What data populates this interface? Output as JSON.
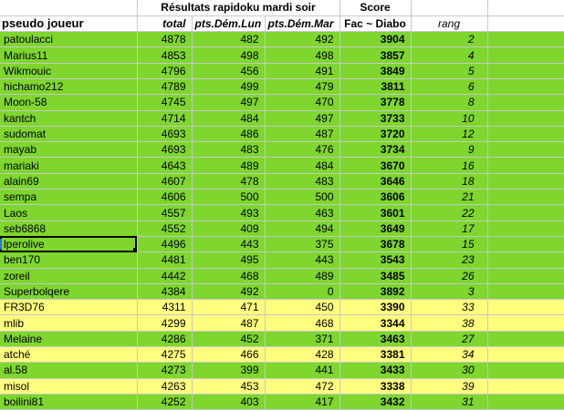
{
  "header": {
    "title": "Résultats rapidoku mardi soir",
    "score_group": "Score",
    "columns": [
      "pseudo joueur",
      "total",
      "pts.Dém.Lun",
      "pts.Dém.Mar",
      "Fac ~ Diabo",
      "rang"
    ]
  },
  "rows": [
    {
      "name": "patoulacci",
      "total": "4878",
      "lun": "482",
      "mar": "492",
      "score": "3904",
      "rang": "2",
      "band": "green"
    },
    {
      "name": "Marius11",
      "total": "4853",
      "lun": "498",
      "mar": "498",
      "score": "3857",
      "rang": "4",
      "band": "green"
    },
    {
      "name": "Wikmouic",
      "total": "4796",
      "lun": "456",
      "mar": "491",
      "score": "3849",
      "rang": "5",
      "band": "green"
    },
    {
      "name": "hichamo212",
      "total": "4789",
      "lun": "499",
      "mar": "479",
      "score": "3811",
      "rang": "6",
      "band": "green"
    },
    {
      "name": "Moon-58",
      "total": "4745",
      "lun": "497",
      "mar": "470",
      "score": "3778",
      "rang": "8",
      "band": "green"
    },
    {
      "name": "kantch",
      "total": "4714",
      "lun": "484",
      "mar": "497",
      "score": "3733",
      "rang": "10",
      "band": "green"
    },
    {
      "name": "sudomat",
      "total": "4693",
      "lun": "486",
      "mar": "487",
      "score": "3720",
      "rang": "12",
      "band": "green"
    },
    {
      "name": "mayab",
      "total": "4693",
      "lun": "483",
      "mar": "476",
      "score": "3734",
      "rang": "9",
      "band": "green"
    },
    {
      "name": "mariaki",
      "total": "4643",
      "lun": "489",
      "mar": "484",
      "score": "3670",
      "rang": "16",
      "band": "green"
    },
    {
      "name": "alain69",
      "total": "4607",
      "lun": "478",
      "mar": "483",
      "score": "3646",
      "rang": "18",
      "band": "green"
    },
    {
      "name": "sempa",
      "total": "4606",
      "lun": "500",
      "mar": "500",
      "score": "3606",
      "rang": "21",
      "band": "green"
    },
    {
      "name": "Laos",
      "total": "4557",
      "lun": "493",
      "mar": "463",
      "score": "3601",
      "rang": "22",
      "band": "green"
    },
    {
      "name": "seb6868",
      "total": "4552",
      "lun": "409",
      "mar": "494",
      "score": "3649",
      "rang": "17",
      "band": "green"
    },
    {
      "name": "lperolive",
      "total": "4496",
      "lun": "443",
      "mar": "375",
      "score": "3678",
      "rang": "15",
      "band": "green",
      "selected": true
    },
    {
      "name": "ben170",
      "total": "4481",
      "lun": "495",
      "mar": "443",
      "score": "3543",
      "rang": "23",
      "band": "green"
    },
    {
      "name": "zoreil",
      "total": "4442",
      "lun": "468",
      "mar": "489",
      "score": "3485",
      "rang": "26",
      "band": "green"
    },
    {
      "name": "Superbolqere",
      "total": "4384",
      "lun": "492",
      "mar": "0",
      "score": "3892",
      "rang": "3",
      "band": "green"
    },
    {
      "name": "FR3D76",
      "total": "4311",
      "lun": "471",
      "mar": "450",
      "score": "3390",
      "rang": "33",
      "band": "yellow"
    },
    {
      "name": "mlib",
      "total": "4299",
      "lun": "487",
      "mar": "468",
      "score": "3344",
      "rang": "38",
      "band": "yellow"
    },
    {
      "name": "Melaine",
      "total": "4286",
      "lun": "452",
      "mar": "371",
      "score": "3463",
      "rang": "27",
      "band": "green"
    },
    {
      "name": "atché",
      "total": "4275",
      "lun": "466",
      "mar": "428",
      "score": "3381",
      "rang": "34",
      "band": "yellow"
    },
    {
      "name": "al.58",
      "total": "4273",
      "lun": "399",
      "mar": "441",
      "score": "3433",
      "rang": "30",
      "band": "green"
    },
    {
      "name": "misol",
      "total": "4263",
      "lun": "453",
      "mar": "472",
      "score": "3338",
      "rang": "39",
      "band": "yellow"
    },
    {
      "name": "boilini81",
      "total": "4252",
      "lun": "403",
      "mar": "417",
      "score": "3432",
      "rang": "31",
      "band": "green"
    }
  ]
}
